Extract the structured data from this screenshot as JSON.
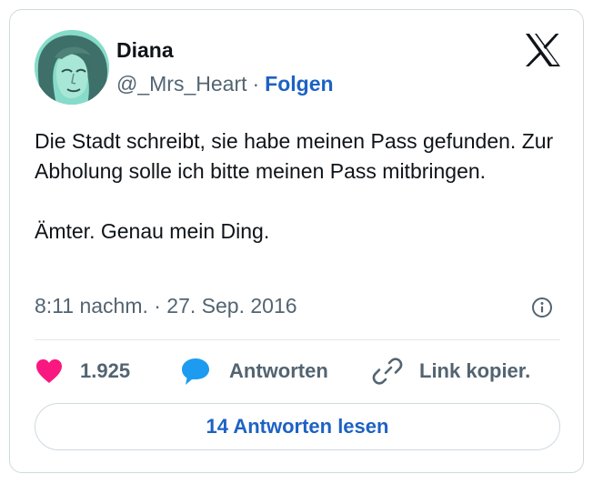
{
  "author": {
    "name": "Diana",
    "handle": "@_Mrs_Heart",
    "separator": "·",
    "follow_label": "Folgen"
  },
  "tweet": {
    "paragraphs": [
      "Die Stadt schreibt, sie habe meinen Pass gefunden. Zur Abholung solle ich bitte meinen Pass mitbringen.",
      "Ämter. Genau mein Ding."
    ],
    "timestamp": "8:11 nachm. · 27. Sep. 2016"
  },
  "actions": {
    "likes_count": "1.925",
    "reply_label": "Antworten",
    "copy_link_label": "Link kopier."
  },
  "read_replies_label": "14 Antworten lesen",
  "icons": {
    "logo": "x-logo-icon",
    "info": "info-icon",
    "like": "heart-icon",
    "reply": "speech-bubble-icon",
    "copy_link": "link-icon"
  },
  "colors": {
    "accent_blue": "#1d62c4",
    "heart": "#f91880",
    "reply_bubble": "#1d9bf0",
    "secondary_text": "#536471",
    "border": "#cfd9de",
    "avatar_tint": "#7fd6c4"
  }
}
